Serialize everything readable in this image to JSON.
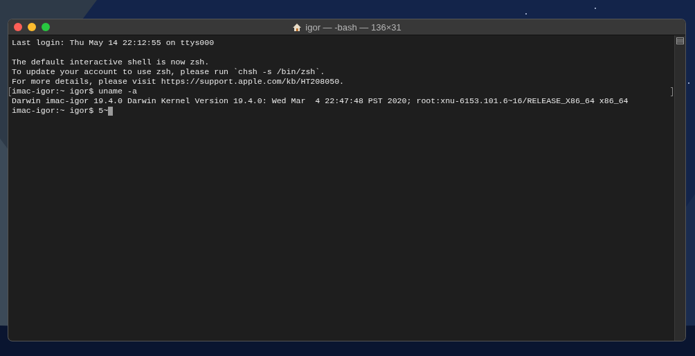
{
  "window": {
    "title": "igor — -bash — 136×31"
  },
  "terminal": {
    "lines": [
      {
        "text": "Last login: Thu May 14 22:12:55 on ttys000",
        "marked": false,
        "cursor": false
      },
      {
        "marked": false,
        "cursor": false
      },
      {
        "text": "The default interactive shell is now zsh.",
        "marked": false,
        "cursor": false
      },
      {
        "text": "To update your account to use zsh, please run `chsh -s /bin/zsh`.",
        "marked": false,
        "cursor": false
      },
      {
        "text": "For more details, please visit https://support.apple.com/kb/HT208050.",
        "marked": false,
        "cursor": false
      },
      {
        "text": "imac-igor:~ igor$ uname -a",
        "marked": true,
        "cursor": false
      },
      {
        "text": "Darwin imac-igor 19.4.0 Darwin Kernel Version 19.4.0: Wed Mar  4 22:47:48 PST 2020; root:xnu-6153.101.6~16/RELEASE_X86_64 x86_64",
        "marked": false,
        "cursor": false
      },
      {
        "text": "imac-igor:~ igor$ 5~",
        "marked": false,
        "cursor": true
      }
    ]
  }
}
